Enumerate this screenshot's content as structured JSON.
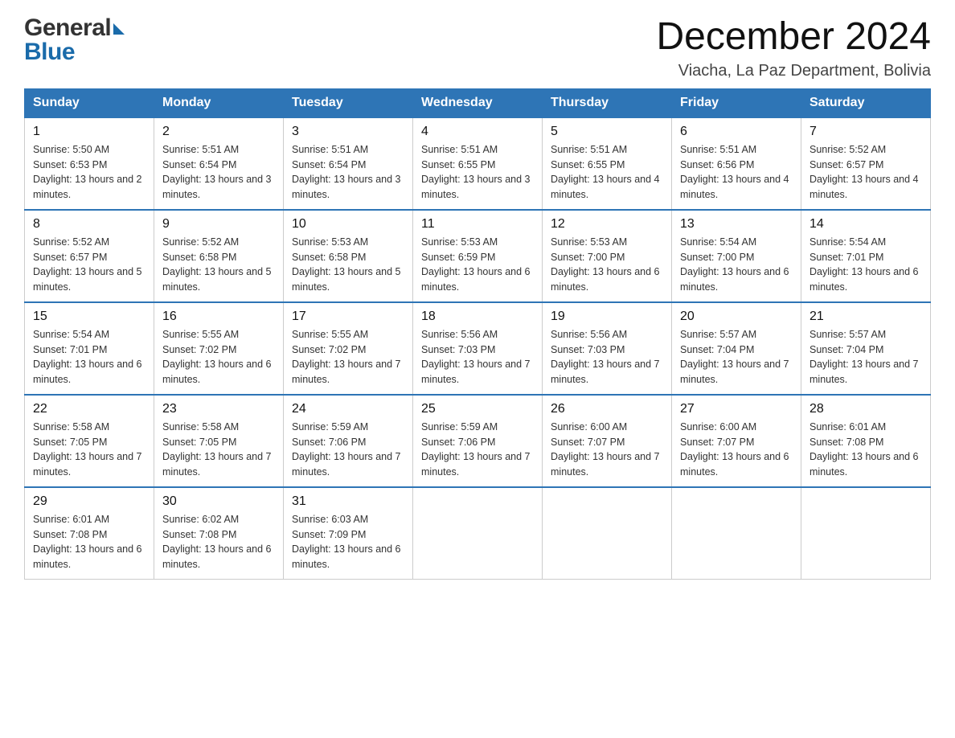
{
  "header": {
    "logo_general": "General",
    "logo_blue": "Blue",
    "main_title": "December 2024",
    "subtitle": "Viacha, La Paz Department, Bolivia"
  },
  "days_of_week": [
    "Sunday",
    "Monday",
    "Tuesday",
    "Wednesday",
    "Thursday",
    "Friday",
    "Saturday"
  ],
  "weeks": [
    [
      {
        "day": "1",
        "sunrise": "Sunrise: 5:50 AM",
        "sunset": "Sunset: 6:53 PM",
        "daylight": "Daylight: 13 hours and 2 minutes."
      },
      {
        "day": "2",
        "sunrise": "Sunrise: 5:51 AM",
        "sunset": "Sunset: 6:54 PM",
        "daylight": "Daylight: 13 hours and 3 minutes."
      },
      {
        "day": "3",
        "sunrise": "Sunrise: 5:51 AM",
        "sunset": "Sunset: 6:54 PM",
        "daylight": "Daylight: 13 hours and 3 minutes."
      },
      {
        "day": "4",
        "sunrise": "Sunrise: 5:51 AM",
        "sunset": "Sunset: 6:55 PM",
        "daylight": "Daylight: 13 hours and 3 minutes."
      },
      {
        "day": "5",
        "sunrise": "Sunrise: 5:51 AM",
        "sunset": "Sunset: 6:55 PM",
        "daylight": "Daylight: 13 hours and 4 minutes."
      },
      {
        "day": "6",
        "sunrise": "Sunrise: 5:51 AM",
        "sunset": "Sunset: 6:56 PM",
        "daylight": "Daylight: 13 hours and 4 minutes."
      },
      {
        "day": "7",
        "sunrise": "Sunrise: 5:52 AM",
        "sunset": "Sunset: 6:57 PM",
        "daylight": "Daylight: 13 hours and 4 minutes."
      }
    ],
    [
      {
        "day": "8",
        "sunrise": "Sunrise: 5:52 AM",
        "sunset": "Sunset: 6:57 PM",
        "daylight": "Daylight: 13 hours and 5 minutes."
      },
      {
        "day": "9",
        "sunrise": "Sunrise: 5:52 AM",
        "sunset": "Sunset: 6:58 PM",
        "daylight": "Daylight: 13 hours and 5 minutes."
      },
      {
        "day": "10",
        "sunrise": "Sunrise: 5:53 AM",
        "sunset": "Sunset: 6:58 PM",
        "daylight": "Daylight: 13 hours and 5 minutes."
      },
      {
        "day": "11",
        "sunrise": "Sunrise: 5:53 AM",
        "sunset": "Sunset: 6:59 PM",
        "daylight": "Daylight: 13 hours and 6 minutes."
      },
      {
        "day": "12",
        "sunrise": "Sunrise: 5:53 AM",
        "sunset": "Sunset: 7:00 PM",
        "daylight": "Daylight: 13 hours and 6 minutes."
      },
      {
        "day": "13",
        "sunrise": "Sunrise: 5:54 AM",
        "sunset": "Sunset: 7:00 PM",
        "daylight": "Daylight: 13 hours and 6 minutes."
      },
      {
        "day": "14",
        "sunrise": "Sunrise: 5:54 AM",
        "sunset": "Sunset: 7:01 PM",
        "daylight": "Daylight: 13 hours and 6 minutes."
      }
    ],
    [
      {
        "day": "15",
        "sunrise": "Sunrise: 5:54 AM",
        "sunset": "Sunset: 7:01 PM",
        "daylight": "Daylight: 13 hours and 6 minutes."
      },
      {
        "day": "16",
        "sunrise": "Sunrise: 5:55 AM",
        "sunset": "Sunset: 7:02 PM",
        "daylight": "Daylight: 13 hours and 6 minutes."
      },
      {
        "day": "17",
        "sunrise": "Sunrise: 5:55 AM",
        "sunset": "Sunset: 7:02 PM",
        "daylight": "Daylight: 13 hours and 7 minutes."
      },
      {
        "day": "18",
        "sunrise": "Sunrise: 5:56 AM",
        "sunset": "Sunset: 7:03 PM",
        "daylight": "Daylight: 13 hours and 7 minutes."
      },
      {
        "day": "19",
        "sunrise": "Sunrise: 5:56 AM",
        "sunset": "Sunset: 7:03 PM",
        "daylight": "Daylight: 13 hours and 7 minutes."
      },
      {
        "day": "20",
        "sunrise": "Sunrise: 5:57 AM",
        "sunset": "Sunset: 7:04 PM",
        "daylight": "Daylight: 13 hours and 7 minutes."
      },
      {
        "day": "21",
        "sunrise": "Sunrise: 5:57 AM",
        "sunset": "Sunset: 7:04 PM",
        "daylight": "Daylight: 13 hours and 7 minutes."
      }
    ],
    [
      {
        "day": "22",
        "sunrise": "Sunrise: 5:58 AM",
        "sunset": "Sunset: 7:05 PM",
        "daylight": "Daylight: 13 hours and 7 minutes."
      },
      {
        "day": "23",
        "sunrise": "Sunrise: 5:58 AM",
        "sunset": "Sunset: 7:05 PM",
        "daylight": "Daylight: 13 hours and 7 minutes."
      },
      {
        "day": "24",
        "sunrise": "Sunrise: 5:59 AM",
        "sunset": "Sunset: 7:06 PM",
        "daylight": "Daylight: 13 hours and 7 minutes."
      },
      {
        "day": "25",
        "sunrise": "Sunrise: 5:59 AM",
        "sunset": "Sunset: 7:06 PM",
        "daylight": "Daylight: 13 hours and 7 minutes."
      },
      {
        "day": "26",
        "sunrise": "Sunrise: 6:00 AM",
        "sunset": "Sunset: 7:07 PM",
        "daylight": "Daylight: 13 hours and 7 minutes."
      },
      {
        "day": "27",
        "sunrise": "Sunrise: 6:00 AM",
        "sunset": "Sunset: 7:07 PM",
        "daylight": "Daylight: 13 hours and 6 minutes."
      },
      {
        "day": "28",
        "sunrise": "Sunrise: 6:01 AM",
        "sunset": "Sunset: 7:08 PM",
        "daylight": "Daylight: 13 hours and 6 minutes."
      }
    ],
    [
      {
        "day": "29",
        "sunrise": "Sunrise: 6:01 AM",
        "sunset": "Sunset: 7:08 PM",
        "daylight": "Daylight: 13 hours and 6 minutes."
      },
      {
        "day": "30",
        "sunrise": "Sunrise: 6:02 AM",
        "sunset": "Sunset: 7:08 PM",
        "daylight": "Daylight: 13 hours and 6 minutes."
      },
      {
        "day": "31",
        "sunrise": "Sunrise: 6:03 AM",
        "sunset": "Sunset: 7:09 PM",
        "daylight": "Daylight: 13 hours and 6 minutes."
      },
      null,
      null,
      null,
      null
    ]
  ]
}
